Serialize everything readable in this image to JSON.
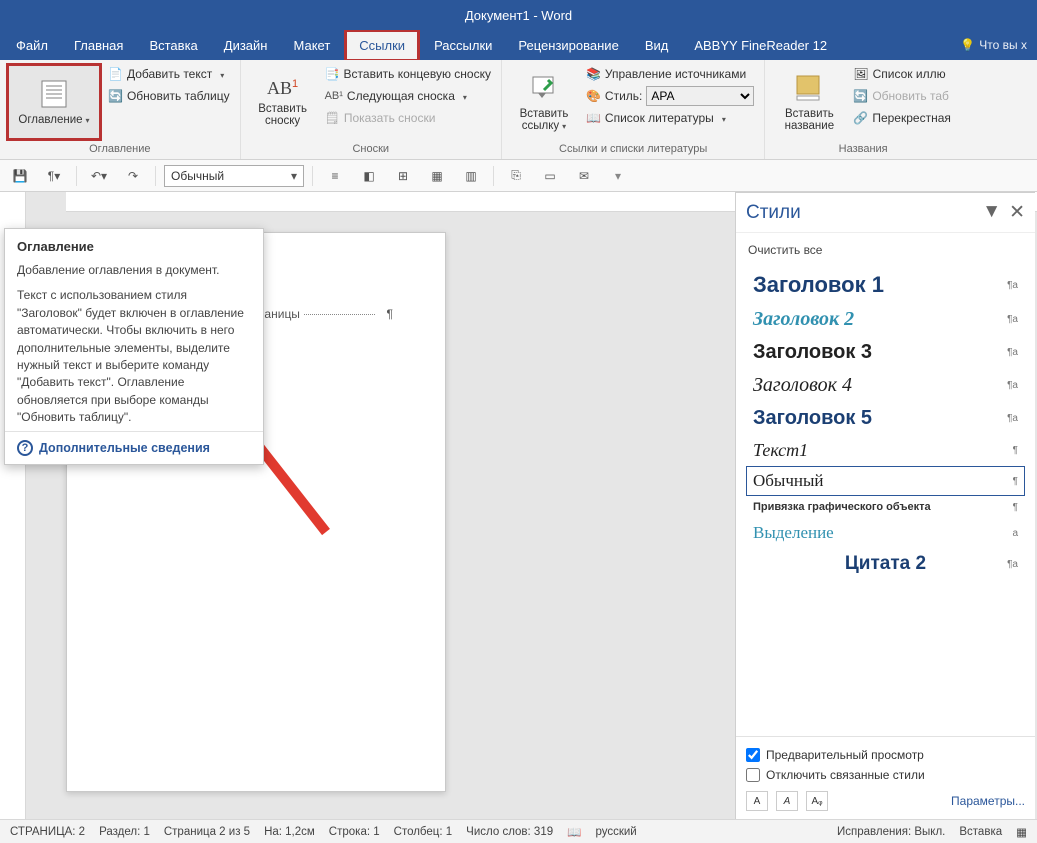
{
  "title": "Документ1 - Word",
  "menu": {
    "file": "Файл",
    "home": "Главная",
    "insert": "Вставка",
    "design": "Дизайн",
    "layout": "Макет",
    "references": "Ссылки",
    "mailings": "Рассылки",
    "review": "Рецензирование",
    "view": "Вид",
    "abbyy": "ABBYY FineReader 12",
    "tell": "Что вы х"
  },
  "ribbon": {
    "toc": {
      "button": "Оглавление",
      "add_text": "Добавить текст",
      "update": "Обновить таблицу",
      "group": "Оглавление"
    },
    "footnotes": {
      "insert": "Вставить\nсноску",
      "endnote": "Вставить концевую сноску",
      "next": "Следующая сноска",
      "show": "Показать сноски",
      "group": "Сноски"
    },
    "cit": {
      "insert": "Вставить\nссылку",
      "manage": "Управление источниками",
      "style_lbl": "Стиль:",
      "style_val": "APA",
      "bibl": "Список литературы",
      "group": "Ссылки и списки литературы"
    },
    "captions": {
      "insert": "Вставить\nназвание",
      "figlist": "Список иллю",
      "update": "Обновить таб",
      "cross": "Перекрестная",
      "group": "Названия"
    }
  },
  "subtoolbar": {
    "style": "Обычный"
  },
  "tooltip": {
    "title": "Оглавление",
    "p1": "Добавление оглавления в документ.",
    "p2": "Текст с использованием стиля \"Заголовок\" будет включен в оглавление автоматически. Чтобы включить в него дополнительные элементы, выделите нужный текст и выберите команду \"Добавить текст\". Оглавление обновляется при выборе команды \"Обновить таблицу\".",
    "more": "Дополнительные сведения"
  },
  "page": {
    "pagebreak": "Разрыв страницы"
  },
  "styles": {
    "title": "Стили",
    "clear": "Очистить все",
    "items": {
      "h1": "Заголовок 1",
      "h2": "Заголовок 2",
      "h3": "Заголовок 3",
      "h4": "Заголовок 4",
      "h5": "Заголовок 5",
      "t1": "Текст1",
      "normal": "Обычный",
      "anchor": "Привязка графического объекта",
      "emph": "Выделение",
      "quote2": "Цитата 2"
    },
    "preview": "Предварительный просмотр",
    "disable_linked": "Отключить связанные стили",
    "options": "Параметры..."
  },
  "status": {
    "page": "СТРАНИЦА: 2",
    "section": "Раздел: 1",
    "pageof": "Страница 2 из 5",
    "at": "На: 1,2см",
    "line": "Строка: 1",
    "col": "Столбец: 1",
    "words": "Число слов: 319",
    "lang": "русский",
    "track": "Исправления: Выкл.",
    "insert": "Вставка"
  }
}
